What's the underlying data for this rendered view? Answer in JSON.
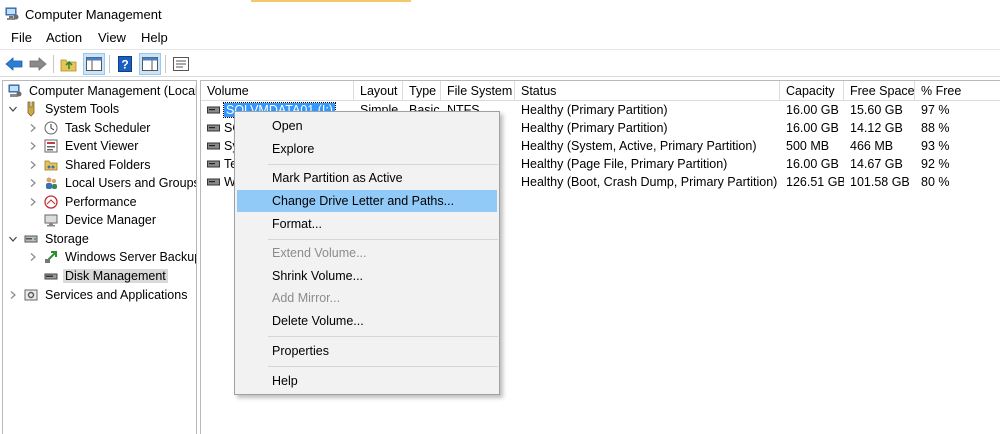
{
  "window": {
    "title": "Computer Management"
  },
  "menu": [
    "File",
    "Action",
    "View",
    "Help"
  ],
  "toolbar": {
    "buttons": [
      "back-arrow-icon",
      "forward-arrow-icon",
      "up-folder-icon",
      "show-hide-tree-icon",
      "help-icon",
      "properties-pane-icon",
      "export-list-icon"
    ]
  },
  "tree": {
    "root": "Computer Management (Local",
    "system_tools": "System Tools",
    "task_scheduler": "Task Scheduler",
    "event_viewer": "Event Viewer",
    "shared_folders": "Shared Folders",
    "local_users": "Local Users and Groups",
    "performance": "Performance",
    "device_manager": "Device Manager",
    "storage": "Storage",
    "wsb": "Windows Server Backup",
    "disk_mgmt": "Disk Management",
    "services": "Services and Applications"
  },
  "columns": [
    "Volume",
    "Layout",
    "Type",
    "File System",
    "Status",
    "Capacity",
    "Free Space",
    "% Free"
  ],
  "rows": [
    {
      "volume": "SOLVMDATA01 (I:)",
      "layout": "Simple",
      "type": "Basic",
      "fs": "NTFS",
      "status": "Healthy (Primary Partition)",
      "capacity": "16.00 GB",
      "free": "15.60 GB",
      "pct": "97 %"
    },
    {
      "volume": "SC",
      "layout": "",
      "type": "",
      "fs": "",
      "status": "Healthy (Primary Partition)",
      "capacity": "16.00 GB",
      "free": "14.12 GB",
      "pct": "88 %"
    },
    {
      "volume": "Sy",
      "layout": "",
      "type": "",
      "fs": "",
      "status": "Healthy (System, Active, Primary Partition)",
      "capacity": "500 MB",
      "free": "466 MB",
      "pct": "93 %"
    },
    {
      "volume": "Te",
      "layout": "",
      "type": "",
      "fs": "",
      "status": "Healthy (Page File, Primary Partition)",
      "capacity": "16.00 GB",
      "free": "14.67 GB",
      "pct": "92 %"
    },
    {
      "volume": "W",
      "layout": "",
      "type": "",
      "fs": "",
      "status": "Healthy (Boot, Crash Dump, Primary Partition)",
      "capacity": "126.51 GB",
      "free": "101.58 GB",
      "pct": "80 %"
    }
  ],
  "context_menu": {
    "open": "Open",
    "explore": "Explore",
    "mark_active": "Mark Partition as Active",
    "change_letter": "Change Drive Letter and Paths...",
    "format": "Format...",
    "extend": "Extend Volume...",
    "shrink": "Shrink Volume...",
    "add_mirror": "Add Mirror...",
    "delete": "Delete Volume...",
    "properties": "Properties",
    "help": "Help"
  },
  "colors": {
    "selection": "#3399ff",
    "menu_highlight": "#91c9f7",
    "menu_bg": "#f2f2f2"
  }
}
